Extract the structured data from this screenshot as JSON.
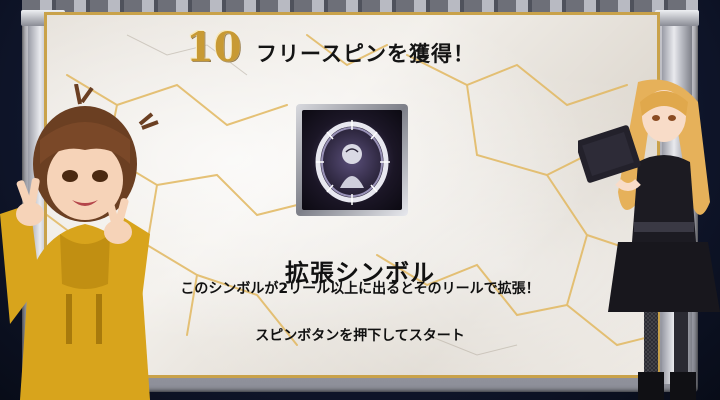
{
  "game": {
    "free_spins_count": "10",
    "free_spins_text": "フリースピンを獲得！",
    "symbol_title": "拡張シンボル",
    "symbol_description": "このシンボルが2リール以上に出るとそのリールで拡張！",
    "start_instruction": "スピンボタンを押下してスタート"
  },
  "colors": {
    "gold": "#c89a34",
    "marble": "#ece8e1",
    "frame_dark": "#0d1326",
    "hoodie": "#d8a41c"
  },
  "icons": {
    "symbol": "expanding-symbol-icon"
  }
}
